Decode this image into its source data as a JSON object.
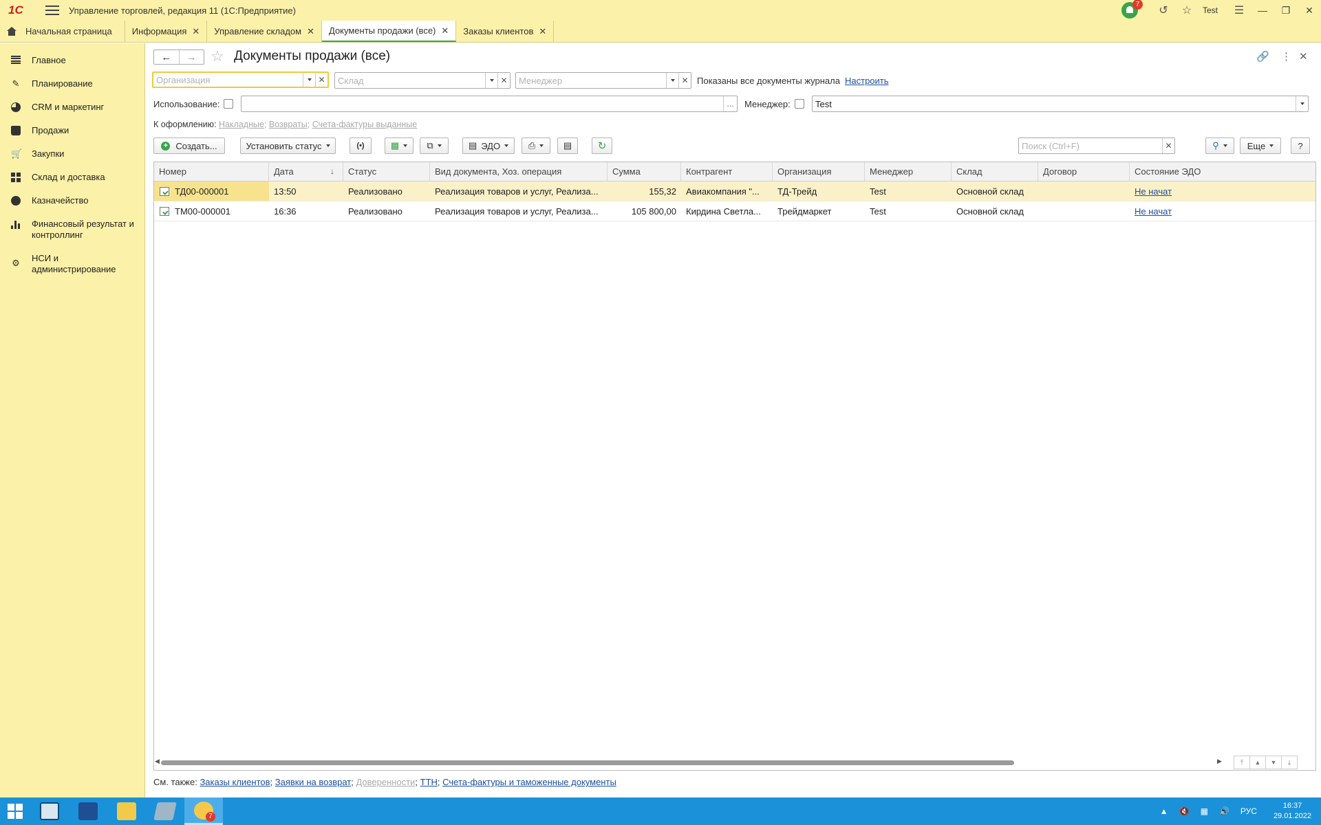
{
  "app": {
    "logo": "1С",
    "title": "Управление торговлей, редакция 11  (1С:Предприятие)",
    "notifications_count": "7",
    "user": "Test"
  },
  "tabs": [
    {
      "label": "Начальная страница"
    },
    {
      "label": "Информация"
    },
    {
      "label": "Управление складом"
    },
    {
      "label": "Документы продажи (все)"
    },
    {
      "label": "Заказы клиентов"
    }
  ],
  "sidebar": {
    "items": [
      {
        "label": "Главное"
      },
      {
        "label": "Планирование"
      },
      {
        "label": "CRM и маркетинг"
      },
      {
        "label": "Продажи"
      },
      {
        "label": "Закупки"
      },
      {
        "label": "Склад и доставка"
      },
      {
        "label": "Казначейство"
      },
      {
        "label": "Финансовый результат и контроллинг"
      },
      {
        "label": "НСИ и администрирование"
      }
    ]
  },
  "page": {
    "title": "Документы продажи (все)",
    "filters": {
      "org_placeholder": "Организация",
      "warehouse_placeholder": "Склад",
      "manager_placeholder": "Менеджер",
      "journal_text": "Показаны все документы журнала",
      "configure_link": "Настроить",
      "usage_label": "Использование:",
      "manager_label": "Менеджер:",
      "manager_value": "Test",
      "ellipsis": "..."
    },
    "to_process": {
      "label": "К оформлению:",
      "links": [
        "Накладные",
        "Возвраты",
        "Счета-фактуры выданные"
      ]
    },
    "toolbar": {
      "create": "Создать...",
      "set_status": "Установить статус",
      "edo": "ЭДО",
      "search_placeholder": "Поиск (Ctrl+F)",
      "more": "Еще",
      "help": "?"
    },
    "table": {
      "columns": [
        "Номер",
        "Дата",
        "Статус",
        "Вид документа, Хоз. операция",
        "Сумма",
        "Контрагент",
        "Организация",
        "Менеджер",
        "Склад",
        "Договор",
        "Состояние ЭДО"
      ],
      "rows": [
        {
          "number": "ТД00-000001",
          "date": "13:50",
          "status": "Реализовано",
          "doc_type": "Реализация товаров и услуг, Реализа...",
          "sum": "155,32",
          "counterparty": "Авиакомпания \"...",
          "org": "ТД-Трейд",
          "manager": "Test",
          "warehouse": "Основной склад",
          "contract": "",
          "edo": "Не начат"
        },
        {
          "number": "ТМ00-000001",
          "date": "16:36",
          "status": "Реализовано",
          "doc_type": "Реализация товаров и услуг, Реализа...",
          "sum": "105 800,00",
          "counterparty": "Кирдина Светла...",
          "org": "Трейдмаркет",
          "manager": "Test",
          "warehouse": "Основной склад",
          "contract": "",
          "edo": "Не начат"
        }
      ]
    },
    "see_also": {
      "label": "См. также:",
      "links": [
        "Заказы клиентов",
        "Заявки на возврат",
        "Доверенности",
        "ТТН",
        "Счета-фактуры и таможенные документы"
      ]
    }
  },
  "taskbar": {
    "lang": "РУС",
    "time": "16:37",
    "date": "29.01.2022",
    "app_badge": "7"
  },
  "colors": {
    "panel_bg": "#fbf1a8",
    "accent_green": "#3aa44a",
    "link_blue": "#1c4fa0",
    "taskbar": "#1a91d8"
  }
}
